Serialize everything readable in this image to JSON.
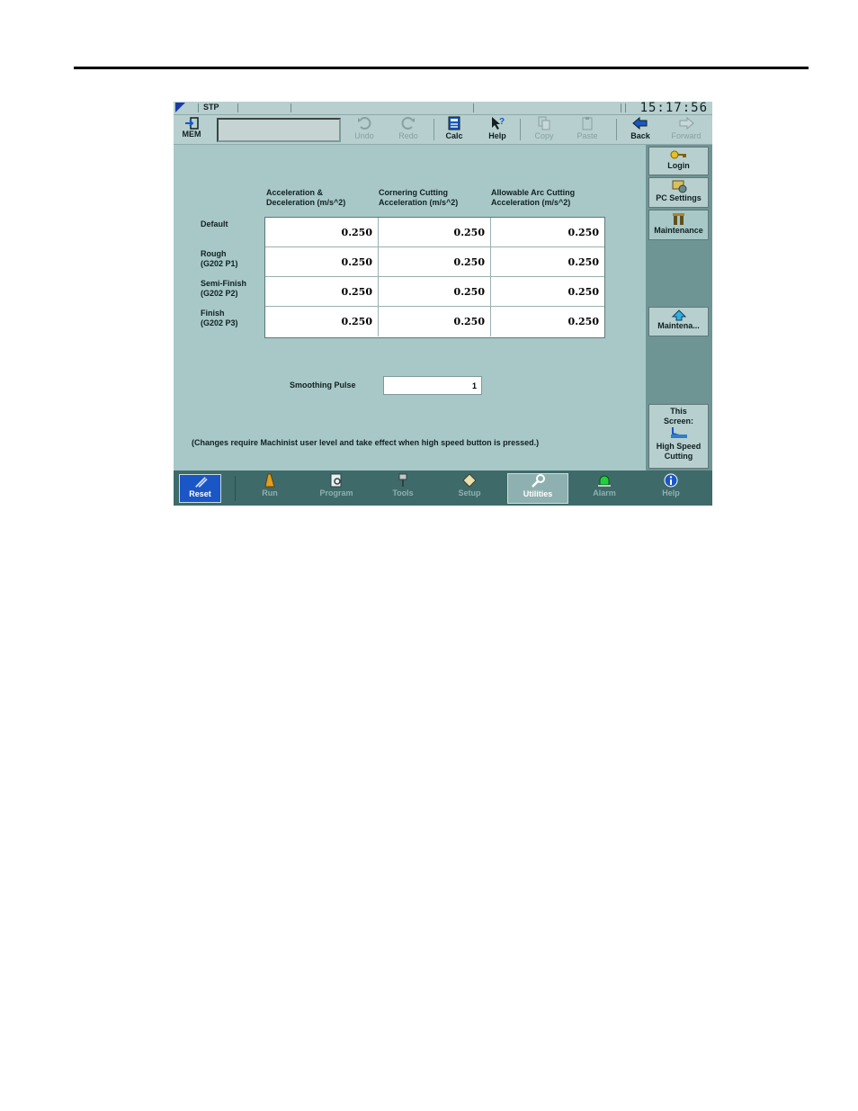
{
  "status": {
    "mode": "STP",
    "clock": "15:17:56"
  },
  "toolbar": {
    "mem_label": "MEM",
    "buttons": [
      {
        "label": "Undo",
        "icon": "undo-icon",
        "enabled": false
      },
      {
        "label": "Redo",
        "icon": "redo-icon",
        "enabled": false
      },
      {
        "label": "Calc",
        "icon": "calculator-icon",
        "enabled": true
      },
      {
        "label": "Help",
        "icon": "help-pointer-icon",
        "enabled": true
      },
      {
        "label": "Copy",
        "icon": "copy-icon",
        "enabled": false
      },
      {
        "label": "Paste",
        "icon": "paste-icon",
        "enabled": false
      },
      {
        "label": "Back",
        "icon": "back-arrow-icon",
        "enabled": true
      },
      {
        "label": "Forward",
        "icon": "forward-arrow-icon",
        "enabled": false
      }
    ]
  },
  "table": {
    "columns": [
      {
        "line1": "Acceleration &",
        "line2": "Deceleration (m/s^2)"
      },
      {
        "line1": "Cornering Cutting",
        "line2": "Acceleration (m/s^2)"
      },
      {
        "line1": "Allowable Arc Cutting",
        "line2": "Acceleration (m/s^2)"
      }
    ],
    "rows": [
      {
        "line1": "Default",
        "line2": "",
        "values": [
          "0.250",
          "0.250",
          "0.250"
        ]
      },
      {
        "line1": "Rough",
        "line2": "(G202 P1)",
        "values": [
          "0.250",
          "0.250",
          "0.250"
        ]
      },
      {
        "line1": "Semi-Finish",
        "line2": "(G202 P2)",
        "values": [
          "0.250",
          "0.250",
          "0.250"
        ]
      },
      {
        "line1": "Finish",
        "line2": "(G202 P3)",
        "values": [
          "0.250",
          "0.250",
          "0.250"
        ]
      }
    ]
  },
  "smoothing": {
    "label": "Smoothing Pulse",
    "value": "1"
  },
  "note": "(Changes require Machinist user level and take effect when high speed button is pressed.)",
  "side": {
    "login": "Login",
    "pc_settings": "PC Settings",
    "maintenance": "Maintenance",
    "maintena": "Maintena...",
    "this_screen_1": "This",
    "this_screen_2": "Screen:",
    "this_screen_3": "High Speed",
    "this_screen_4": "Cutting"
  },
  "nav": {
    "reset": "Reset",
    "items": [
      "Run",
      "Program",
      "Tools",
      "Setup",
      "Utilities",
      "Alarm",
      "Help"
    ],
    "active": "Utilities"
  },
  "colors": {
    "screen_bg": "#a8c8c8",
    "nav_bg": "#3f6a6a",
    "reset_blue": "#1a56c6"
  }
}
